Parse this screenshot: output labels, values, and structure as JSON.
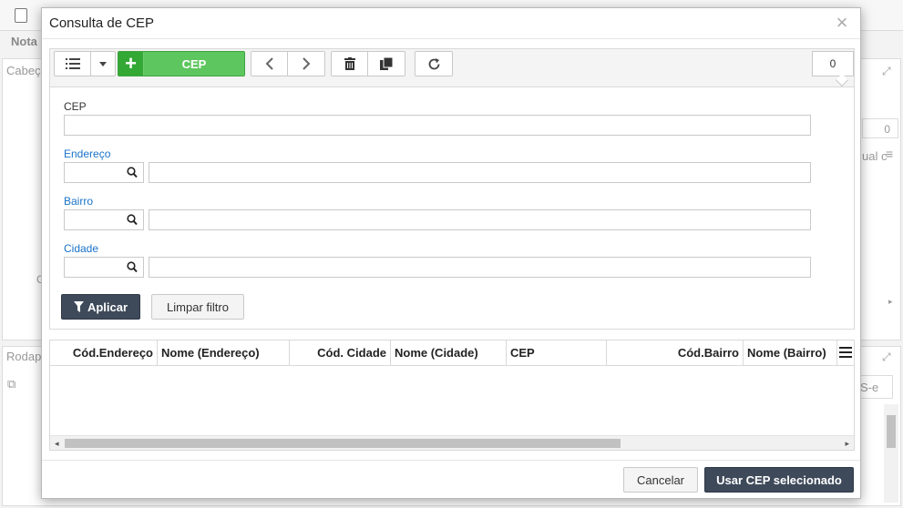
{
  "background": {
    "nota_label": "Nota",
    "panel_header_label": "Cabeç",
    "footer_panel_label": "Rodap",
    "counter_value": "0",
    "column_text": "ual c",
    "side_letter": "C",
    "nfse_text": "S-e"
  },
  "modal": {
    "title": "Consulta de CEP",
    "close_symbol": "×"
  },
  "toolbar": {
    "green_button_label": "CEP",
    "record_count": "0"
  },
  "filter": {
    "cep_label": "CEP",
    "cep_value": "",
    "endereco_label": "Endereço",
    "endereco_code": "",
    "endereco_name": "",
    "bairro_label": "Bairro",
    "bairro_code": "",
    "bairro_name": "",
    "cidade_label": "Cidade",
    "cidade_code": "",
    "cidade_name": "",
    "apply_label": "Aplicar",
    "clear_label": "Limpar filtro"
  },
  "grid": {
    "columns": [
      "Cód.Endereço",
      "Nome (Endereço)",
      "Cód. Cidade",
      "Nome (Cidade)",
      "CEP",
      "Cód.Bairro",
      "Nome (Bairro)"
    ]
  },
  "footer": {
    "cancel_label": "Cancelar",
    "use_label": "Usar CEP selecionado"
  },
  "colors": {
    "primary_dark": "#3e4a5a",
    "green": "#5ec65e",
    "link_blue": "#1a73c8"
  }
}
